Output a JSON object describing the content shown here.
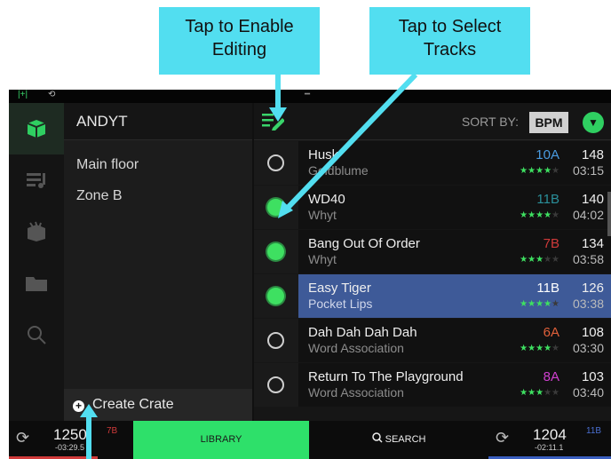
{
  "callouts": {
    "edit_line1": "Tap to Enable",
    "edit_line2": "Editing",
    "select_line1": "Tap to Select",
    "select_line2": "Tracks"
  },
  "colors": {
    "callout_bg": "#52def0",
    "accent_green": "#2fcf61",
    "selected_row": "#3e5a98"
  },
  "crates": {
    "title": "ANDYT",
    "items": [
      "Main floor",
      "Zone B"
    ],
    "create_label": "Create Crate"
  },
  "tracks": {
    "sort_label": "SORT BY:",
    "sort_value": "BPM",
    "rows": [
      {
        "title": "Husk",
        "artist": "Goldblume",
        "key": "10A",
        "key_color": "#4a9be0",
        "bpm": "148",
        "duration": "03:15",
        "rating": 4,
        "selected": false
      },
      {
        "title": "WD40",
        "artist": "Whyt",
        "key": "11B",
        "key_color": "#2a8f9a",
        "bpm": "140",
        "duration": "04:02",
        "rating": 4,
        "selected": true
      },
      {
        "title": "Bang Out Of Order",
        "artist": "Whyt",
        "key": "7B",
        "key_color": "#d03a3a",
        "bpm": "134",
        "duration": "03:58",
        "rating": 3,
        "selected": true
      },
      {
        "title": "Easy Tiger",
        "artist": "Pocket Lips",
        "key": "11B",
        "key_color": "#ffffff",
        "bpm": "126",
        "duration": "03:38",
        "rating": 4,
        "selected": true
      },
      {
        "title": "Dah Dah Dah Dah",
        "artist": "Word Association",
        "key": "6A",
        "key_color": "#e0603a",
        "bpm": "108",
        "duration": "03:30",
        "rating": 4,
        "selected": false
      },
      {
        "title": "Return To The Playground",
        "artist": "Word Association",
        "key": "8A",
        "key_color": "#d040d0",
        "bpm": "103",
        "duration": "03:40",
        "rating": 3,
        "selected": false
      }
    ]
  },
  "bottombar": {
    "left_deck": {
      "bpm": "1250",
      "time": "-03:29.5",
      "key": "7B"
    },
    "library_label": "LIBRARY",
    "search_label": "SEARCH",
    "right_deck": {
      "bpm": "1204",
      "time": "-02:11.1",
      "key": "11B"
    }
  },
  "icons": {
    "edit": "edit-list-icon",
    "sort_toggle": "chevron-down-icon",
    "nav": [
      "crate-icon",
      "playlist-icon",
      "library-box-icon",
      "folder-icon",
      "search-icon"
    ]
  }
}
